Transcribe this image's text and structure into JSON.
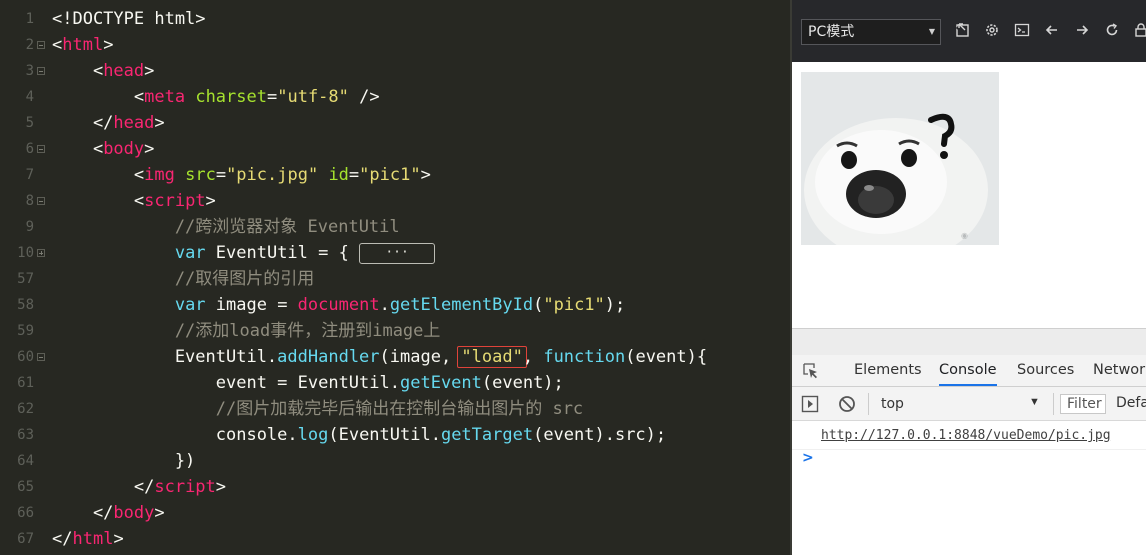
{
  "editor": {
    "lines": [
      {
        "num": "1",
        "fold": "",
        "segs": [
          {
            "t": "<!DOCTYPE html>",
            "c": "plain"
          }
        ]
      },
      {
        "num": "2",
        "fold": "minus",
        "segs": [
          {
            "t": "<",
            "c": "plain"
          },
          {
            "t": "html",
            "c": "tag"
          },
          {
            "t": ">",
            "c": "plain"
          }
        ]
      },
      {
        "num": "3",
        "fold": "minus",
        "indent": 1,
        "segs": [
          {
            "t": "    <",
            "c": "plain"
          },
          {
            "t": "head",
            "c": "tag"
          },
          {
            "t": ">",
            "c": "plain"
          }
        ]
      },
      {
        "num": "4",
        "fold": "",
        "indent": 2,
        "segs": [
          {
            "t": "        <",
            "c": "plain"
          },
          {
            "t": "meta",
            "c": "tag"
          },
          {
            "t": " ",
            "c": "plain"
          },
          {
            "t": "charset",
            "c": "attr"
          },
          {
            "t": "=",
            "c": "plain"
          },
          {
            "t": "\"utf-8\"",
            "c": "str"
          },
          {
            "t": " />",
            "c": "plain"
          }
        ]
      },
      {
        "num": "5",
        "fold": "",
        "indent": 1,
        "segs": [
          {
            "t": "    </",
            "c": "plain"
          },
          {
            "t": "head",
            "c": "tag"
          },
          {
            "t": ">",
            "c": "plain"
          }
        ]
      },
      {
        "num": "6",
        "fold": "minus",
        "indent": 1,
        "segs": [
          {
            "t": "    <",
            "c": "plain"
          },
          {
            "t": "body",
            "c": "tag"
          },
          {
            "t": ">",
            "c": "plain"
          }
        ]
      },
      {
        "num": "7",
        "fold": "",
        "indent": 2,
        "segs": [
          {
            "t": "        <",
            "c": "plain"
          },
          {
            "t": "img",
            "c": "tag"
          },
          {
            "t": " ",
            "c": "plain"
          },
          {
            "t": "src",
            "c": "attr"
          },
          {
            "t": "=",
            "c": "plain"
          },
          {
            "t": "\"pic.jpg\"",
            "c": "str"
          },
          {
            "t": " ",
            "c": "plain"
          },
          {
            "t": "id",
            "c": "attr"
          },
          {
            "t": "=",
            "c": "plain"
          },
          {
            "t": "\"pic1\"",
            "c": "str"
          },
          {
            "t": ">",
            "c": "plain"
          }
        ]
      },
      {
        "num": "8",
        "fold": "minus",
        "indent": 2,
        "segs": [
          {
            "t": "        <",
            "c": "plain"
          },
          {
            "t": "script",
            "c": "tag"
          },
          {
            "t": ">",
            "c": "plain"
          }
        ]
      },
      {
        "num": "9",
        "fold": "",
        "indent": 3,
        "segs": [
          {
            "t": "            //跨浏览器对象 EventUtil",
            "c": "cm"
          }
        ]
      },
      {
        "num": "10",
        "fold": "plus",
        "indent": 3,
        "segs": [
          {
            "t": "            ",
            "c": "plain"
          },
          {
            "t": "var",
            "c": "kw"
          },
          {
            "t": " EventUtil = { ",
            "c": "plain"
          },
          {
            "t": "···",
            "c": "dots"
          }
        ]
      },
      {
        "num": "57",
        "fold": "",
        "indent": 3,
        "segs": [
          {
            "t": "            //取得图片的引用",
            "c": "cm"
          }
        ]
      },
      {
        "num": "58",
        "fold": "",
        "indent": 3,
        "segs": [
          {
            "t": "            ",
            "c": "plain"
          },
          {
            "t": "var",
            "c": "kw"
          },
          {
            "t": " image = ",
            "c": "plain"
          },
          {
            "t": "document",
            "c": "obj"
          },
          {
            "t": ".",
            "c": "plain"
          },
          {
            "t": "getElementById",
            "c": "fn"
          },
          {
            "t": "(",
            "c": "plain"
          },
          {
            "t": "\"pic1\"",
            "c": "str"
          },
          {
            "t": ");",
            "c": "plain"
          }
        ]
      },
      {
        "num": "59",
        "fold": "",
        "indent": 3,
        "segs": [
          {
            "t": "            //添加load事件，注册到image上",
            "c": "cm"
          }
        ]
      },
      {
        "num": "60",
        "fold": "minus",
        "indent": 3,
        "segs": [
          {
            "t": "            EventUtil.",
            "c": "plain"
          },
          {
            "t": "addHandler",
            "c": "fn"
          },
          {
            "t": "(image, ",
            "c": "plain"
          },
          {
            "t": "\"load\"",
            "c": "str boxed"
          },
          {
            "t": ", ",
            "c": "plain"
          },
          {
            "t": "function",
            "c": "kw"
          },
          {
            "t": "(event){",
            "c": "plain"
          }
        ]
      },
      {
        "num": "61",
        "fold": "",
        "indent": 4,
        "segs": [
          {
            "t": "                event = EventUtil.",
            "c": "plain"
          },
          {
            "t": "getEvent",
            "c": "fn"
          },
          {
            "t": "(event);",
            "c": "plain"
          }
        ]
      },
      {
        "num": "62",
        "fold": "",
        "indent": 4,
        "segs": [
          {
            "t": "                //图片加载完毕后输出在控制台输出图片的 src",
            "c": "cm"
          }
        ]
      },
      {
        "num": "63",
        "fold": "",
        "indent": 4,
        "segs": [
          {
            "t": "                console.",
            "c": "plain"
          },
          {
            "t": "log",
            "c": "fn"
          },
          {
            "t": "(EventUtil.",
            "c": "plain"
          },
          {
            "t": "getTarget",
            "c": "fn"
          },
          {
            "t": "(event).src);",
            "c": "plain"
          }
        ]
      },
      {
        "num": "64",
        "fold": "",
        "indent": 3,
        "segs": [
          {
            "t": "            })",
            "c": "plain"
          }
        ]
      },
      {
        "num": "65",
        "fold": "",
        "indent": 2,
        "segs": [
          {
            "t": "        </",
            "c": "plain"
          },
          {
            "t": "script",
            "c": "tag"
          },
          {
            "t": ">",
            "c": "plain"
          }
        ]
      },
      {
        "num": "66",
        "fold": "",
        "indent": 1,
        "segs": [
          {
            "t": "    </",
            "c": "plain"
          },
          {
            "t": "body",
            "c": "tag"
          },
          {
            "t": ">",
            "c": "plain"
          }
        ]
      },
      {
        "num": "67",
        "fold": "",
        "segs": [
          {
            "t": "</",
            "c": "plain"
          },
          {
            "t": "html",
            "c": "tag"
          },
          {
            "t": ">",
            "c": "plain"
          }
        ]
      }
    ]
  },
  "browser": {
    "mode_label": "PC模式",
    "toolbar_icons": [
      "open-external-icon",
      "settings-icon",
      "terminal-icon",
      "back-arrow-icon",
      "forward-arrow-icon",
      "refresh-icon",
      "lock-icon"
    ]
  },
  "devtools": {
    "tabs": [
      {
        "label": "Elements",
        "active": false
      },
      {
        "label": "Console",
        "active": true
      },
      {
        "label": "Sources",
        "active": false
      },
      {
        "label": "Network",
        "active": false
      }
    ],
    "context": "top",
    "filter_placeholder": "Filter",
    "levels_label": "Defa",
    "log_entries": [
      "http://127.0.0.1:8848/vueDemo/pic.jpg"
    ],
    "prompt": ">"
  }
}
